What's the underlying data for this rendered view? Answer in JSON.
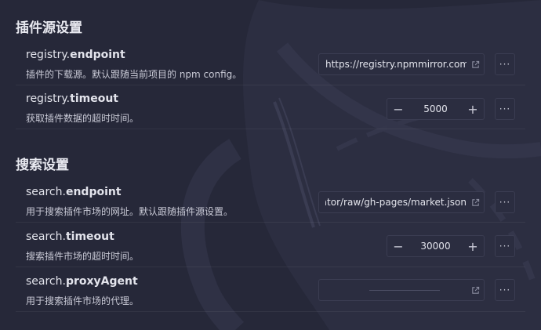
{
  "sections": [
    {
      "title": "插件源设置",
      "items": [
        {
          "key_prefix": "registry.",
          "key_bold": "endpoint",
          "description": "插件的下载源。默认跟随当前项目的 npm config。",
          "control": "text",
          "value": "https://registry.npmmirror.com"
        },
        {
          "key_prefix": "registry.",
          "key_bold": "timeout",
          "description": "获取插件数据的超时时间。",
          "control": "number",
          "value": "5000"
        }
      ]
    },
    {
      "title": "搜索设置",
      "items": [
        {
          "key_prefix": "search.",
          "key_bold": "endpoint",
          "description": "用于搜索插件市场的网址。默认跟随插件源设置。",
          "control": "text",
          "value": "regator/raw/gh-pages/market.json"
        },
        {
          "key_prefix": "search.",
          "key_bold": "timeout",
          "description": "搜索插件市场的超时时间。",
          "control": "number",
          "value": "30000"
        },
        {
          "key_prefix": "search.",
          "key_bold": "proxyAgent",
          "description": "用于搜索插件市场的代理。",
          "control": "text",
          "value": ""
        }
      ]
    }
  ],
  "icons": {
    "external_link": "external-link-icon",
    "more": "ellipsis-icon",
    "minus": "minus-icon",
    "plus": "plus-icon"
  },
  "glyphs": {
    "minus": "−",
    "plus": "+",
    "more": "···"
  },
  "colors": {
    "background": "#262839",
    "input_bg": "#2b2d40",
    "input_border": "#3b3d52",
    "text": "#e3e4ec"
  }
}
